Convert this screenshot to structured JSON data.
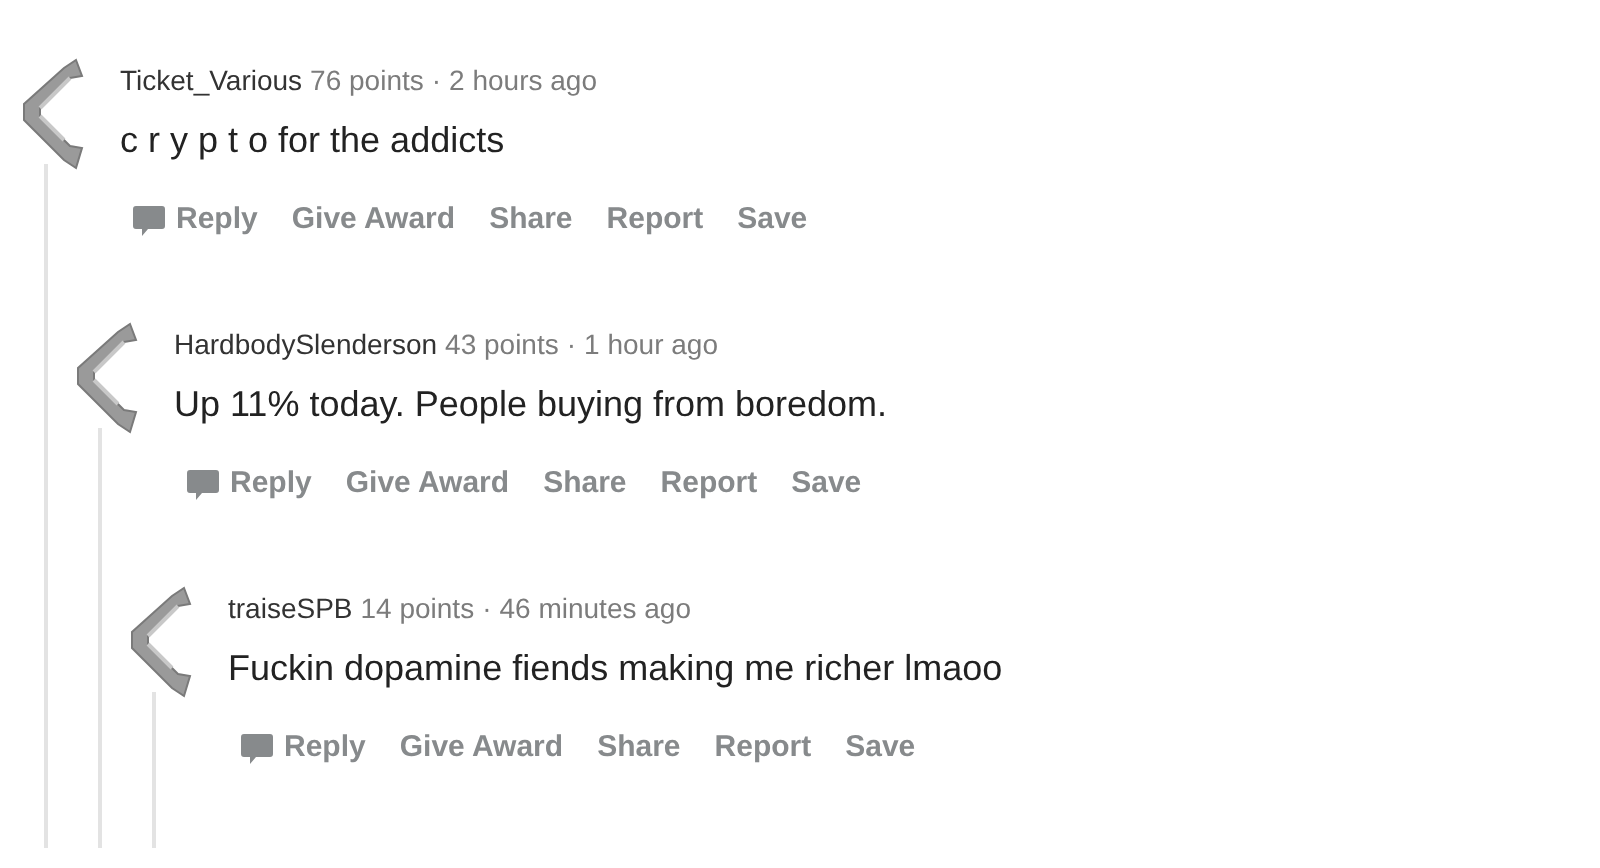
{
  "comments": [
    {
      "author": "Ticket_Various",
      "points": "76 points",
      "separator": "·",
      "time": "2 hours ago",
      "body": "c r y p t o for the addicts",
      "actions": [
        {
          "label": "Reply",
          "kind": "reply"
        },
        {
          "label": "Give Award",
          "kind": "plain"
        },
        {
          "label": "Share",
          "kind": "plain"
        },
        {
          "label": "Report",
          "kind": "plain"
        },
        {
          "label": "Save",
          "kind": "plain"
        }
      ],
      "children": [
        {
          "author": "HardbodySlenderson",
          "points": "43 points",
          "separator": "·",
          "time": "1 hour ago",
          "body": "Up 11% today. People buying from boredom.",
          "actions": [
            {
              "label": "Reply",
              "kind": "reply"
            },
            {
              "label": "Give Award",
              "kind": "plain"
            },
            {
              "label": "Share",
              "kind": "plain"
            },
            {
              "label": "Report",
              "kind": "plain"
            },
            {
              "label": "Save",
              "kind": "plain"
            }
          ],
          "children": [
            {
              "author": "traiseSPB",
              "points": "14 points",
              "separator": "·",
              "time": "46 minutes ago",
              "body": "Fuckin dopamine fiends making me richer lmaoo",
              "actions": [
                {
                  "label": "Reply",
                  "kind": "reply"
                },
                {
                  "label": "Give Award",
                  "kind": "plain"
                },
                {
                  "label": "Share",
                  "kind": "plain"
                },
                {
                  "label": "Report",
                  "kind": "plain"
                },
                {
                  "label": "Save",
                  "kind": "plain"
                }
              ]
            }
          ]
        }
      ]
    }
  ]
}
